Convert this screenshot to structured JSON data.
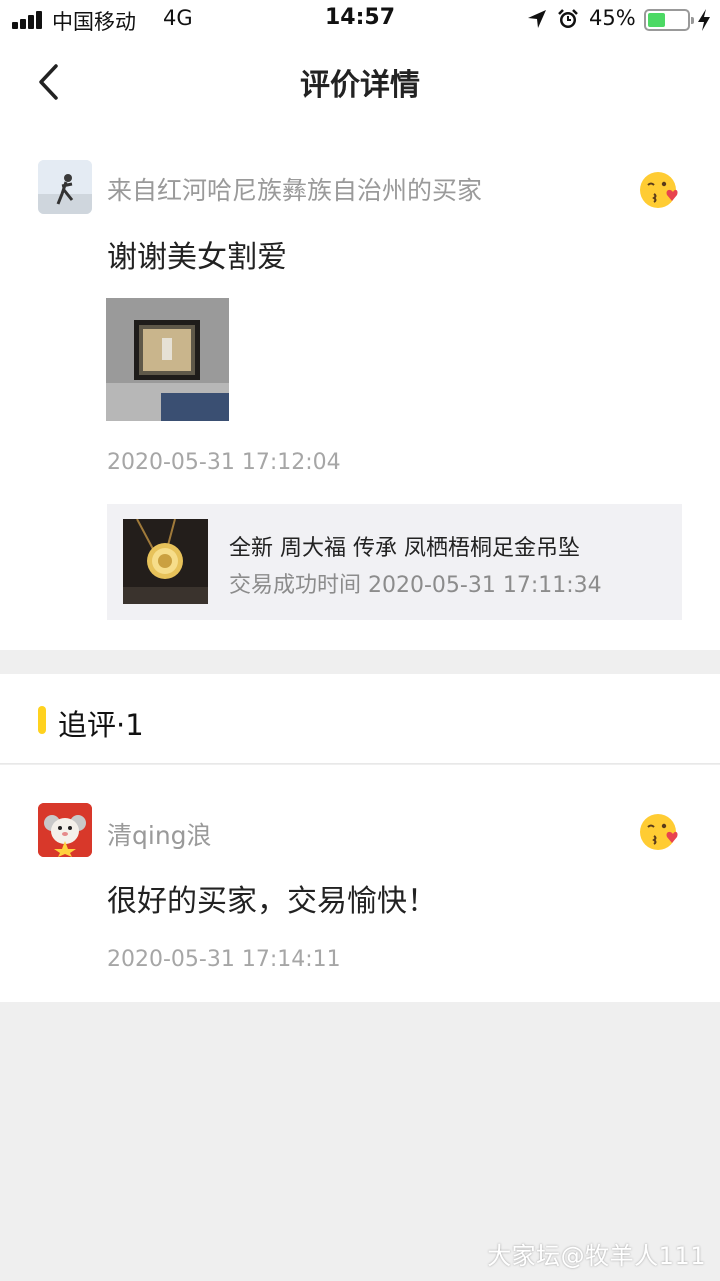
{
  "status_bar": {
    "carrier": "中国移动",
    "network": "4G",
    "time": "14:57",
    "battery_percent": "45%",
    "battery_level": 0.45,
    "icons": [
      "signal-icon",
      "location-icon",
      "alarm-icon",
      "battery-icon",
      "charging-icon"
    ]
  },
  "nav": {
    "title": "评价详情",
    "back_icon": "back-chevron-icon"
  },
  "review": {
    "nickname": "来自红河哈尼族彝族自治州的买家",
    "emoji_icon": "kiss-face-emoji-icon",
    "comment": "谢谢美女割爱",
    "date": "2020-05-31 17:12:04",
    "product": {
      "name": "全新 周大福 传承 凤栖梧桐足金吊坠",
      "trade_time": "交易成功时间 2020-05-31 17:11:34"
    }
  },
  "followup": {
    "header": "追评·1",
    "accent_color": "#ffd21f",
    "nickname": "清qing浪",
    "emoji_icon": "kiss-face-emoji-icon",
    "comment": "很好的买家，交易愉快！",
    "date": "2020-05-31 17:14:11"
  },
  "watermark": "大家坛@牧羊人111"
}
